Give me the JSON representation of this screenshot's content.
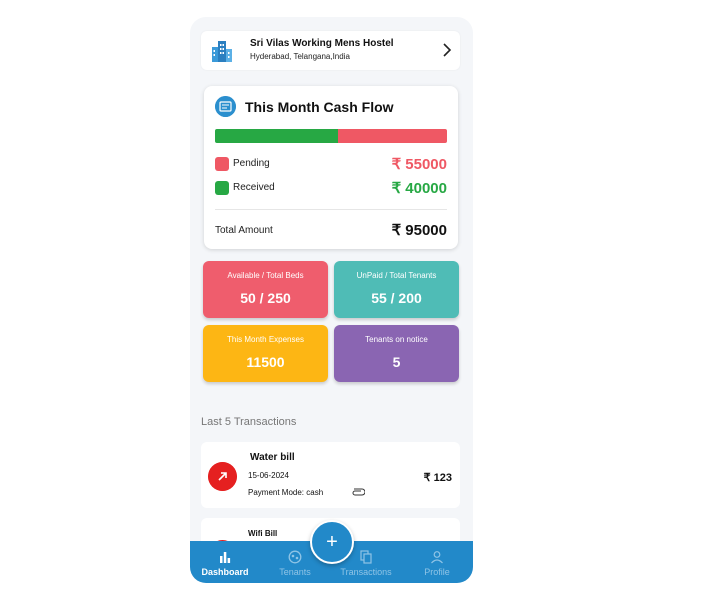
{
  "hostel": {
    "name": "Sri Vilas Working Mens Hostel",
    "location": "Hyderabad, Telangana,India"
  },
  "cash_flow": {
    "title": "This Month Cash Flow",
    "received_fraction": 0.53,
    "pending_label": "Pending",
    "pending_amount": "₹ 55000",
    "received_label": "Received",
    "received_amount": "₹ 40000",
    "total_label": "Total Amount",
    "total_amount": "₹ 95000",
    "colors": {
      "pending": "#ef5864",
      "received": "#27a844"
    }
  },
  "tiles": [
    {
      "label": "Available / Total Beds",
      "value": "50 / 250",
      "color": "#ef5d6d"
    },
    {
      "label": "UnPaid / Total Tenants",
      "value": "55 / 200",
      "color": "#4fbcb6"
    },
    {
      "label": "This Month Expenses",
      "value": "11500",
      "color": "#fdb614"
    },
    {
      "label": "Tenants on notice",
      "value": "5",
      "color": "#8a65b2"
    }
  ],
  "transactions_section": {
    "title": "Last 5 Transactions"
  },
  "transactions": [
    {
      "name": "Water bill",
      "date": "15-06-2024",
      "mode": "Payment Mode: cash",
      "amount": "₹ 123"
    },
    {
      "name": "Wifi Bill"
    }
  ],
  "nav": {
    "items": [
      {
        "label": "Dashboard",
        "icon": "bar-chart-icon"
      },
      {
        "label": "Tenants",
        "icon": "tenants-icon"
      },
      {
        "label": "Transactions",
        "icon": "copy-icon"
      },
      {
        "label": "Profile",
        "icon": "person-icon"
      }
    ],
    "fab_label": "+"
  }
}
